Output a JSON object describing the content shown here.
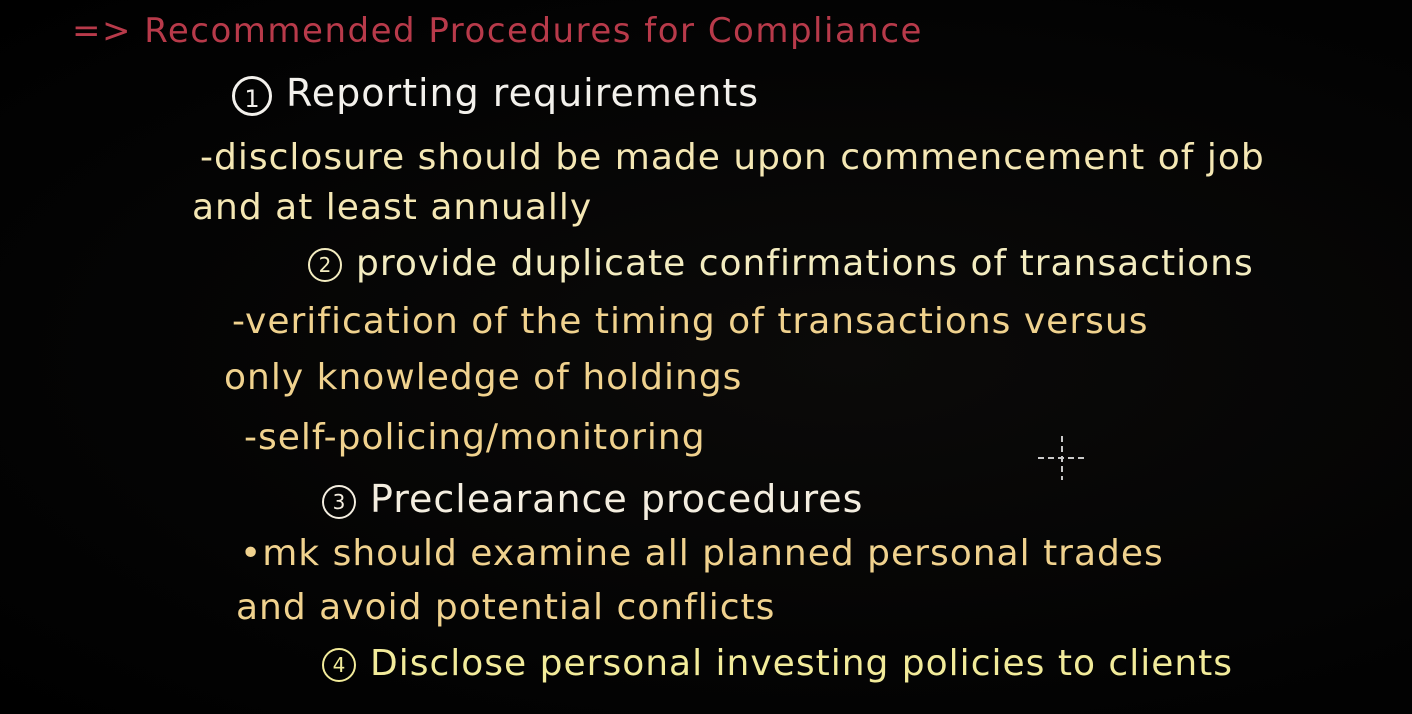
{
  "heading": {
    "arrow": "=>",
    "text": "Recommended Procedures for Compliance"
  },
  "items": [
    {
      "number": "1",
      "title": "Reporting requirements",
      "details": [
        "-disclosure should be made upon commencement of job",
        "and at least annually"
      ]
    },
    {
      "number": "2",
      "title": "provide duplicate confirmations of transactions",
      "details": [
        "-verification of the timing of transactions versus",
        "only knowledge of holdings",
        "-self-policing/monitoring"
      ]
    },
    {
      "number": "3",
      "title": "Preclearance procedures",
      "details": [
        "•mk should examine all planned personal trades",
        "and avoid potential conflicts"
      ]
    },
    {
      "number": "4",
      "title": "Disclose personal investing policies to clients",
      "details": []
    }
  ],
  "colors": {
    "background": "#000000",
    "heading": "#b83a4a",
    "item_title": "#f3f1ec",
    "detail_text": "#f0d28e",
    "last_item_title": "#f2eb9a"
  }
}
